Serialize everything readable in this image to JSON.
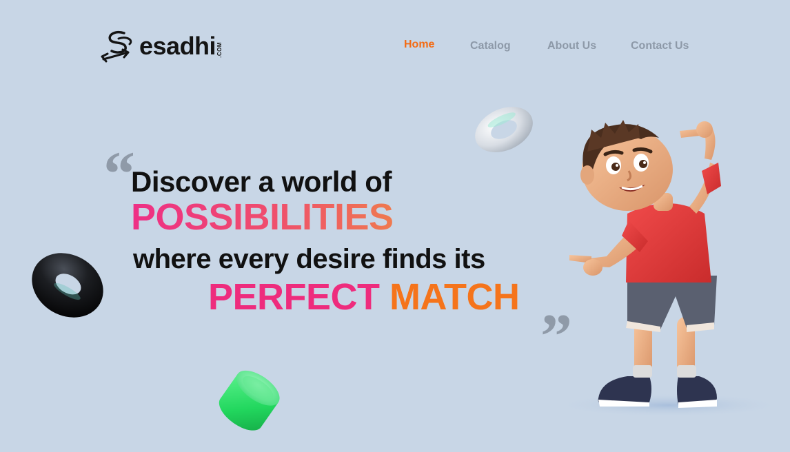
{
  "brand": {
    "name": "esadhi",
    "suffix": ".COM"
  },
  "nav": {
    "items": [
      {
        "label": "Home",
        "active": true
      },
      {
        "label": "Catalog",
        "active": false
      },
      {
        "label": "About Us",
        "active": false
      },
      {
        "label": "Contact Us",
        "active": false
      }
    ]
  },
  "hero": {
    "line1": "Discover a world of",
    "line2": "POSSIBILITIES",
    "line3": "where every desire finds its",
    "line4_part1": "PERFECT",
    "line4_part2": "MATCH"
  },
  "colors": {
    "background": "#c8d6e6",
    "accent_orange": "#f36b14",
    "accent_pink": "#ee2c7d",
    "nav_inactive": "#8d99a8"
  }
}
